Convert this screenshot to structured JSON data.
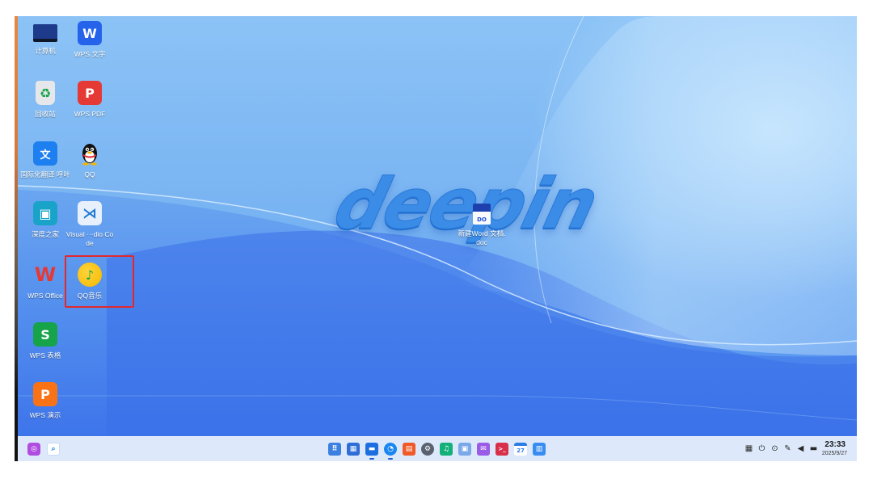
{
  "wallpaper": {
    "brand_text": "deepin"
  },
  "desktop_icons": [
    {
      "label": "计算机",
      "icon": "computer-icon",
      "glyph": ""
    },
    {
      "label": "WPS 文字",
      "icon": "wps-writer-icon",
      "glyph": "W"
    },
    {
      "label": "回收站",
      "icon": "trash-icon",
      "glyph": "♻"
    },
    {
      "label": "WPS PDF",
      "icon": "wps-pdf-icon",
      "glyph": "P"
    },
    {
      "label": "国际化翻译 呼叶",
      "icon": "translate-icon",
      "glyph": "文"
    },
    {
      "label": "QQ",
      "icon": "qq-penguin-icon",
      "glyph": ""
    },
    {
      "label": "深度之家",
      "icon": "deepin-home-icon",
      "glyph": "▣"
    },
    {
      "label": "Visual ···dio Code",
      "icon": "vscode-icon",
      "glyph": "⋊"
    },
    {
      "label": "WPS Office",
      "icon": "wps-office-icon",
      "glyph": "W"
    },
    {
      "label": "QQ音乐",
      "icon": "qq-music-icon",
      "glyph": "♪"
    },
    {
      "label": "WPS 表格",
      "icon": "wps-spreadsheet-icon",
      "glyph": "S"
    },
    {
      "label": "WPS 演示",
      "icon": "wps-presentation-icon",
      "glyph": "P"
    },
    {
      "label": "新建Word 文档.doc",
      "icon": "word-document-icon",
      "glyph": "DO"
    }
  ],
  "taskbar": {
    "left": [
      {
        "name": "launcher-icon",
        "glyph": "◎",
        "color": "#b04ce0"
      },
      {
        "name": "search-icon",
        "glyph": "⌕",
        "color": "#2a8cf0"
      }
    ],
    "apps": [
      {
        "name": "app-grid-icon",
        "glyph": "⠿",
        "color": "#3b7fe0",
        "running": false
      },
      {
        "name": "multitask-view-icon",
        "glyph": "▦",
        "color": "#2e6ed6",
        "running": false
      },
      {
        "name": "file-manager-icon",
        "glyph": "▬",
        "color": "#1d6fe0",
        "running": true
      },
      {
        "name": "browser-icon",
        "glyph": "◔",
        "color": "#1a86f0",
        "running": true
      },
      {
        "name": "app-store-icon",
        "glyph": "▤",
        "color": "#f05a28",
        "running": false
      },
      {
        "name": "settings-gear-icon",
        "glyph": "⚙",
        "color": "#5a6170",
        "running": false
      },
      {
        "name": "music-player-icon",
        "glyph": "♫",
        "color": "#13b07a",
        "running": false
      },
      {
        "name": "image-viewer-icon",
        "glyph": "▣",
        "color": "#7aa8e8",
        "running": false
      },
      {
        "name": "mail-icon",
        "glyph": "✉",
        "color": "#9a5ce6",
        "running": false
      },
      {
        "name": "terminal-icon",
        "glyph": ">_",
        "color": "#d8304a",
        "running": false
      },
      {
        "name": "calendar-icon",
        "glyph": "27",
        "color": "#2c7de6",
        "running": false
      },
      {
        "name": "trash-dock-icon",
        "glyph": "▥",
        "color": "#3a8df0",
        "running": false
      }
    ],
    "tray": [
      {
        "name": "keyboard-layout-icon",
        "glyph": "▦"
      },
      {
        "name": "power-icon",
        "glyph": "⏻"
      },
      {
        "name": "notification-icon",
        "glyph": "⊙"
      },
      {
        "name": "pen-icon",
        "glyph": "✎"
      },
      {
        "name": "volume-icon",
        "glyph": "◀"
      },
      {
        "name": "network-icon",
        "glyph": "▬"
      }
    ],
    "clock_time": "23:33",
    "clock_date": "2025/9/27"
  }
}
